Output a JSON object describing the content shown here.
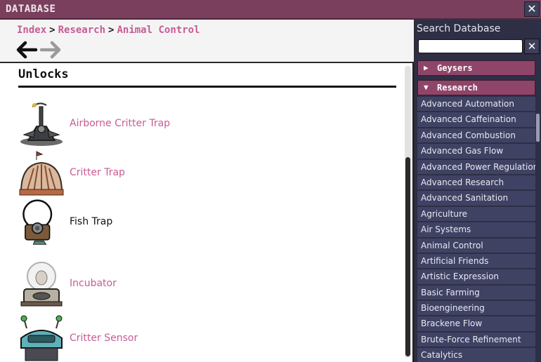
{
  "window": {
    "title": "DATABASE",
    "close_label": "✕"
  },
  "breadcrumb": {
    "index": "Index",
    "research": "Research",
    "current": "Animal Control",
    "separator": ">"
  },
  "section": {
    "title": "Unlocks"
  },
  "unlocks": [
    {
      "label": "Airborne Critter Trap",
      "linked": true
    },
    {
      "label": "Critter Trap",
      "linked": true
    },
    {
      "label": "Fish Trap",
      "linked": false
    },
    {
      "label": "Incubator",
      "linked": true
    },
    {
      "label": "Critter Sensor",
      "linked": true
    }
  ],
  "sidebar": {
    "search_label": "Search Database",
    "search_value": "",
    "clear_label": "✕",
    "categories": [
      {
        "label": "Geysers",
        "arrow": "▶"
      },
      {
        "label": "Research",
        "arrow": "▼"
      }
    ],
    "items": [
      "Advanced Automation",
      "Advanced Caffeination",
      "Advanced Combustion",
      "Advanced Gas Flow",
      "Advanced Power Regulation",
      "Advanced Research",
      "Advanced Sanitation",
      "Agriculture",
      "Air Systems",
      "Animal Control",
      "Artificial Friends",
      "Artistic Expression",
      "Basic Farming",
      "Bioengineering",
      "Brackene Flow",
      "Brute-Force Refinement",
      "Catalytics"
    ]
  },
  "colors": {
    "link": "#c75b95",
    "titlebar": "#7a3f5c",
    "sidebar": "#2e2f45",
    "category": "#8f4569",
    "list_item": "#3f4263"
  }
}
